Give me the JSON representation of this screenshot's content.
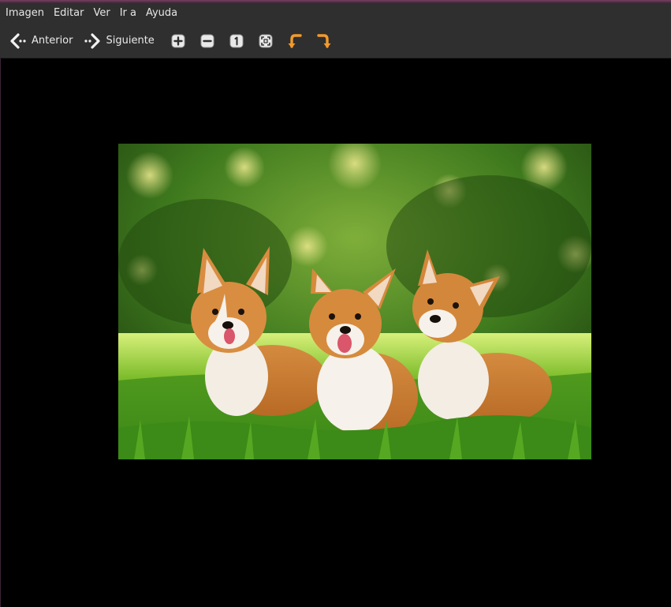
{
  "menubar": {
    "items": [
      "Imagen",
      "Editar",
      "Ver",
      "Ir a",
      "Ayuda"
    ]
  },
  "toolbar": {
    "previous_label": "Anterior",
    "next_label": "Siguiente",
    "icons": [
      "zoom-in-icon",
      "zoom-out-icon",
      "zoom-normal-icon",
      "zoom-fit-icon",
      "rotate-left-icon",
      "rotate-right-icon"
    ]
  },
  "colors": {
    "chrome_bg": "#2f2f2f",
    "chrome_text": "#e6e6e6",
    "viewer_bg": "#000000",
    "rotate_orange": "#f39a2c",
    "window_accent": "#7a3f63"
  },
  "image": {
    "subject": "three corgi dogs sitting on grass"
  }
}
